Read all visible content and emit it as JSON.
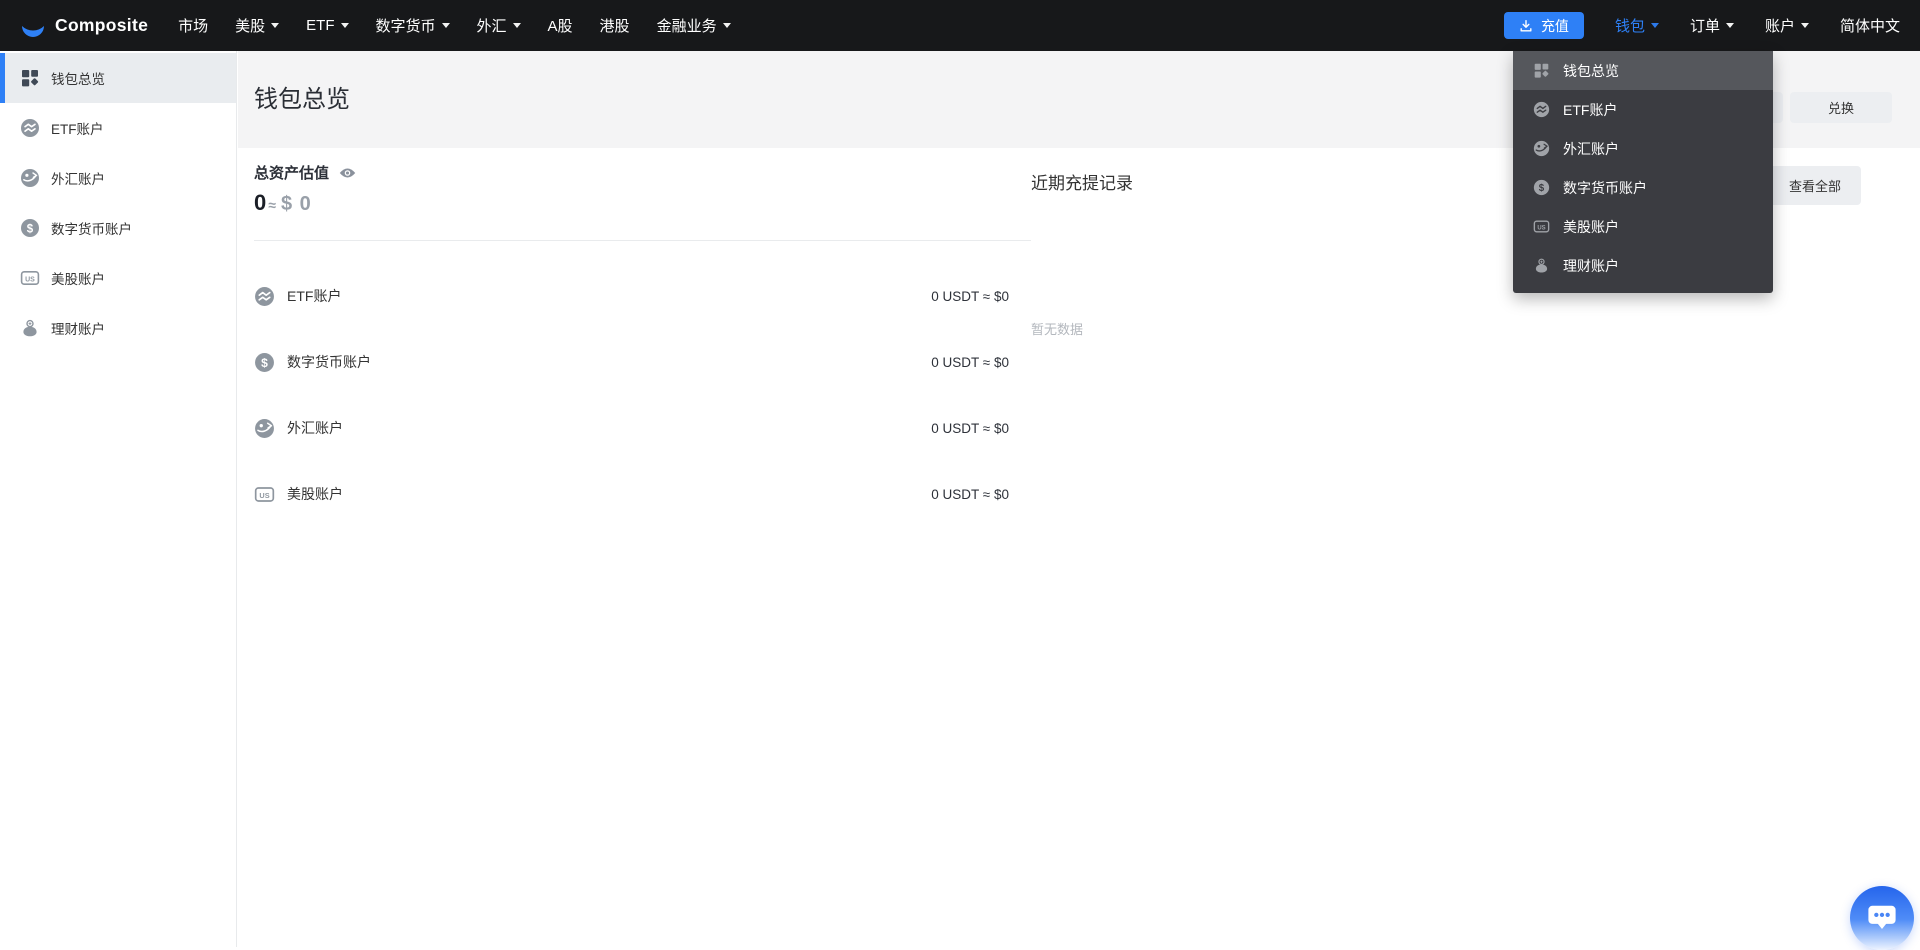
{
  "brand": {
    "name": "Composite"
  },
  "navbar": {
    "items": [
      {
        "label": "市场",
        "dropdown": false
      },
      {
        "label": "美股",
        "dropdown": true
      },
      {
        "label": "ETF",
        "dropdown": true
      },
      {
        "label": "数字货币",
        "dropdown": true
      },
      {
        "label": "外汇",
        "dropdown": true
      },
      {
        "label": "A股",
        "dropdown": false
      },
      {
        "label": "港股",
        "dropdown": false
      },
      {
        "label": "金融业务",
        "dropdown": true
      }
    ],
    "recharge_label": "充值",
    "user_menu": [
      {
        "label": "钱包",
        "dropdown": true,
        "active": true
      },
      {
        "label": "订单",
        "dropdown": true,
        "active": false
      },
      {
        "label": "账户",
        "dropdown": true,
        "active": false
      },
      {
        "label": "简体中文",
        "dropdown": false,
        "active": false
      }
    ]
  },
  "sidebar": {
    "items": [
      {
        "icon": "grid",
        "label": "钱包总览",
        "active": true
      },
      {
        "icon": "etf",
        "label": "ETF账户",
        "active": false
      },
      {
        "icon": "forex",
        "label": "外汇账户",
        "active": false
      },
      {
        "icon": "crypto",
        "label": "数字货币账户",
        "active": false
      },
      {
        "icon": "us",
        "label": "美股账户",
        "active": false
      },
      {
        "icon": "piggy",
        "label": "理财账户",
        "active": false
      }
    ]
  },
  "wallet_dropdown": {
    "items": [
      {
        "icon": "grid",
        "label": "钱包总览",
        "active": true
      },
      {
        "icon": "etf",
        "label": "ETF账户",
        "active": false
      },
      {
        "icon": "forex",
        "label": "外汇账户",
        "active": false
      },
      {
        "icon": "crypto",
        "label": "数字货币账户",
        "active": false
      },
      {
        "icon": "us",
        "label": "美股账户",
        "active": false
      },
      {
        "icon": "piggy",
        "label": "理财账户",
        "active": false
      }
    ]
  },
  "page": {
    "title": "钱包总览",
    "exchange_button": "兑换",
    "assets": {
      "label": "总资产估值",
      "amount": "0",
      "approx": "≈",
      "usd": "$ 0"
    },
    "accounts": [
      {
        "icon": "etf",
        "name": "ETF账户",
        "value": "0 USDT ≈ $0"
      },
      {
        "icon": "crypto",
        "name": "数字货币账户",
        "value": "0 USDT ≈ $0"
      },
      {
        "icon": "forex",
        "name": "外汇账户",
        "value": "0 USDT ≈ $0"
      },
      {
        "icon": "us",
        "name": "美股账户",
        "value": "0 USDT ≈ $0"
      }
    ],
    "records": {
      "title": "近期充提记录",
      "view_all": "查看全部",
      "empty": "暂无数据"
    }
  },
  "colors": {
    "accent": "#2e80f6",
    "navbar_bg": "#17181a",
    "dropdown_bg": "#3b3c41",
    "dropdown_active_bg": "#55575c",
    "header_band_bg": "#f4f4f5",
    "sidebar_active_bg": "#e9ecef",
    "icon_gray": "#8e969f",
    "muted_text": "#b3b7bd"
  }
}
